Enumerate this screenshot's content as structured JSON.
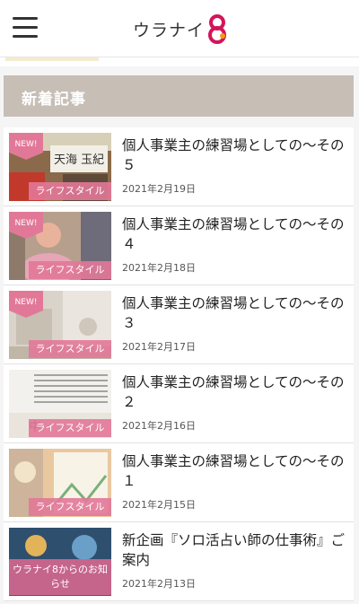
{
  "header": {
    "logo_text": "ウラナイ",
    "logo_icon": "logo-8-icon",
    "menu_icon": "hamburger-icon"
  },
  "section": {
    "title": "新着記事"
  },
  "articles": [
    {
      "title": "個人事業主の練習場としての〜その５",
      "date": "2021年2月19日",
      "category": "ライフスタイル",
      "badge": "NEW!"
    },
    {
      "title": "個人事業主の練習場としての〜その４",
      "date": "2021年2月18日",
      "category": "ライフスタイル",
      "badge": "NEW!"
    },
    {
      "title": "個人事業主の練習場としての〜その３",
      "date": "2021年2月17日",
      "category": "ライフスタイル",
      "badge": "NEW!"
    },
    {
      "title": "個人事業主の練習場としての〜その２",
      "date": "2021年2月16日",
      "category": "ライフスタイル",
      "badge": ""
    },
    {
      "title": "個人事業主の練習場としての〜その１",
      "date": "2021年2月15日",
      "category": "ライフスタイル",
      "badge": ""
    },
    {
      "title": "新企画『ソロ活占い師の仕事術』ご案内",
      "date": "2021年2月13日",
      "category": "ウラナイ8からのお知らせ",
      "badge": ""
    }
  ],
  "colors": {
    "section_bg": "#c7beb6",
    "badge": "#e27898",
    "logo_accent": "#d4145a"
  }
}
